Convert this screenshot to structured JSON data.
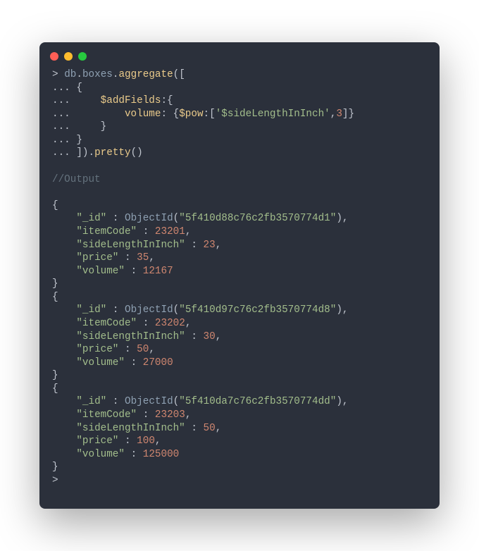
{
  "window": {
    "dots": [
      "red",
      "yellow",
      "green"
    ]
  },
  "query": {
    "prompt": ">",
    "dots": "...",
    "db": "db",
    "collection": "boxes",
    "aggregate": "aggregate",
    "openBracket": "([",
    "openBrace": "{",
    "addFields": "$addFields",
    "colonBrace": ":{",
    "volumeKey": "volume",
    "colon": ":",
    "spaceBrace": " {",
    "pow": "$pow",
    "colonBracket": ":[",
    "sideLengthStr": "'$sideLengthInInch'",
    "comma": ",",
    "powNum": "3",
    "closePow": "]}",
    "closeBrace": "}",
    "closeAgg": "]).",
    "pretty": "pretty",
    "parens": "()"
  },
  "comment": "//Output",
  "results": [
    {
      "idLabel": "\"_id\"",
      "objectIdFn": "ObjectId",
      "objectIdVal": "\"5f410d88c76c2fb3570774d1\"",
      "itemCodeLabel": "\"itemCode\"",
      "itemCode": "23201",
      "sideLabel": "\"sideLengthInInch\"",
      "side": "23",
      "priceLabel": "\"price\"",
      "price": "35",
      "volumeLabel": "\"volume\"",
      "volume": "12167"
    },
    {
      "idLabel": "\"_id\"",
      "objectIdFn": "ObjectId",
      "objectIdVal": "\"5f410d97c76c2fb3570774d8\"",
      "itemCodeLabel": "\"itemCode\"",
      "itemCode": "23202",
      "sideLabel": "\"sideLengthInInch\"",
      "side": "30",
      "priceLabel": "\"price\"",
      "price": "50",
      "volumeLabel": "\"volume\"",
      "volume": "27000"
    },
    {
      "idLabel": "\"_id\"",
      "objectIdFn": "ObjectId",
      "objectIdVal": "\"5f410da7c76c2fb3570774dd\"",
      "itemCodeLabel": "\"itemCode\"",
      "itemCode": "23203",
      "sideLabel": "\"sideLengthInInch\"",
      "side": "50",
      "priceLabel": "\"price\"",
      "price": "100",
      "volumeLabel": "\"volume\"",
      "volume": "125000"
    }
  ],
  "finalPrompt": ">"
}
